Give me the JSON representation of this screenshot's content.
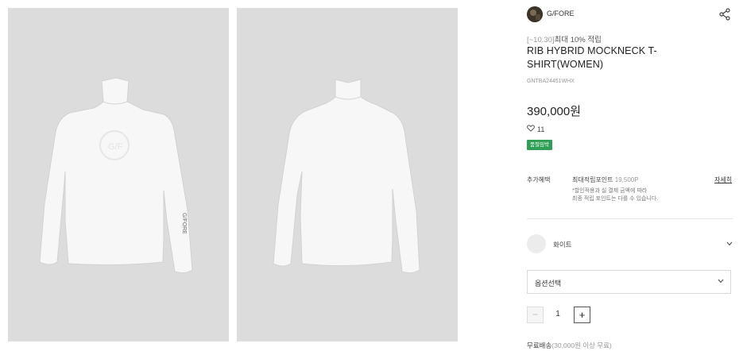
{
  "gallery": {
    "images": [
      {
        "icon": "front-shirt-image",
        "print": "G/FORE"
      },
      {
        "icon": "back-shirt-image"
      }
    ]
  },
  "brand": {
    "name": "G/FORE",
    "icon": "brand-avatar"
  },
  "share": {
    "icon": "share-icon"
  },
  "promo": {
    "date": "[~10.30]",
    "text": "최대 10% 적립"
  },
  "product": {
    "title": "RIB HYBRID MOCKNECK T-SHIRT(WOMEN)",
    "code": "GNTBA24451WHX",
    "price": "390,000원",
    "likes": "11",
    "badge": "품절임박"
  },
  "benefit": {
    "label": "추가혜택",
    "point_label": "최대적립포인트",
    "point_value": "19,500P",
    "detail_link": "자세히",
    "note_line1": "*할인적용과 실 결제 금액에 따라",
    "note_line2": "최종 적립 포인트는 다를 수 있습니다."
  },
  "color_option": {
    "name": "화이트",
    "icon": "chevron-down-icon"
  },
  "option_select": {
    "label": "옵션선택",
    "icon": "chevron-down-icon"
  },
  "quantity": {
    "minus": "−",
    "value": "1",
    "plus": "+"
  },
  "shipping": {
    "text": "무료배송",
    "detail": "(30,000원 이상 무료)"
  },
  "colors": {
    "badge_green": "#2e9f55",
    "image_bg": "#dcdcdc"
  }
}
